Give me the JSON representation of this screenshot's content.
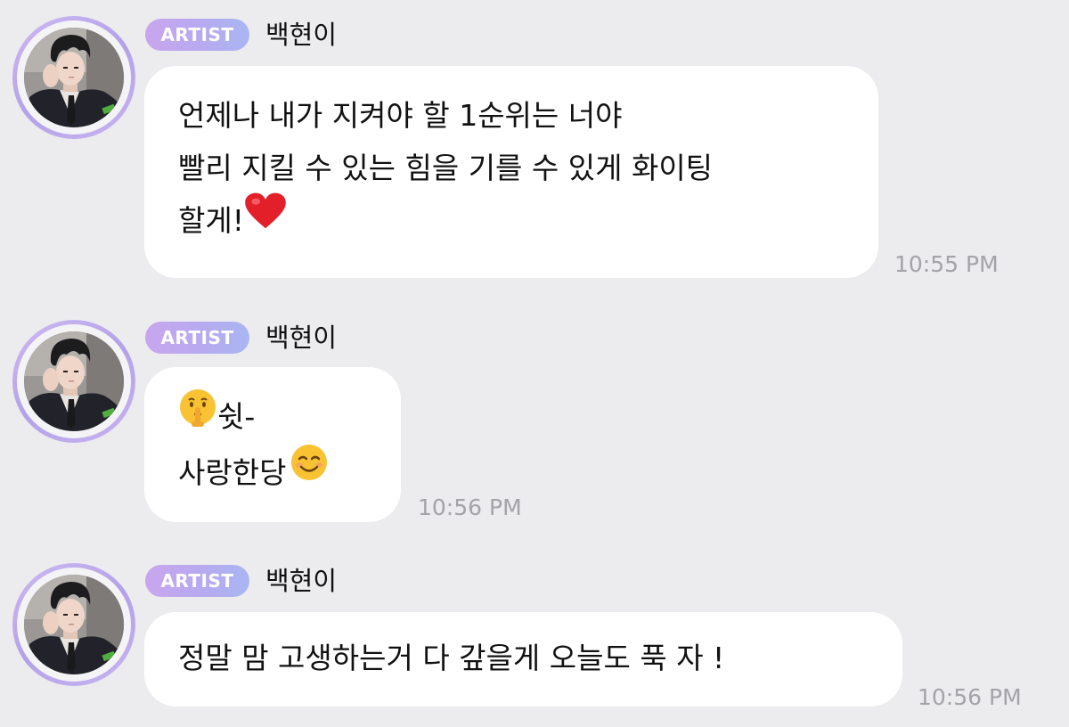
{
  "messages": [
    {
      "badge": "ARTIST",
      "sender": "백현이",
      "lines": [
        "언제나 내가 지켜야 할 1순위는 너야",
        "빨리 지킬 수 있는 힘을 기를 수 있게 화이팅",
        "할게!"
      ],
      "emoji": "heart-emoji",
      "time": "10:55 PM"
    },
    {
      "badge": "ARTIST",
      "sender": "백현이",
      "lines": [
        "쉿-",
        "사랑한당"
      ],
      "emoji": [
        "shushing-face-emoji",
        "smiling-face-emoji"
      ],
      "time": "10:56 PM"
    },
    {
      "badge": "ARTIST",
      "sender": "백현이",
      "lines": [
        "정말 맘 고생하는거 다 갚을게 오늘도 푹 자 !"
      ],
      "time": "10:56 PM"
    }
  ],
  "colors": {
    "background": "#ececee",
    "bubble": "#ffffff",
    "badge_gradient": [
      "#c8a6ee",
      "#a9b6f2"
    ],
    "avatar_ring": "#b3a2e8",
    "timestamp": "#a3a3a8"
  }
}
